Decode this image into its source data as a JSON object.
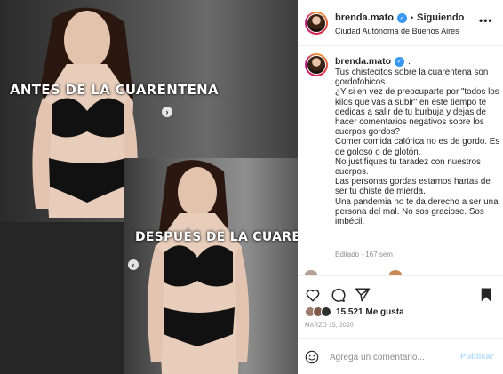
{
  "post": {
    "text_before": "ANTES DE LA CUARENTENA",
    "text_after": "DESPUÉS DE LA CUARENTENA",
    "nav_next_icon": "chevron-right-icon",
    "nav_prev_icon": "chevron-left-icon"
  },
  "header": {
    "username": "brenda.mato",
    "separator": "•",
    "follow_label": "Siguiendo",
    "location": "Ciudad Autónoma de Buenos Aires",
    "more_label": "•••"
  },
  "caption": {
    "username": "brenda.mato",
    "trailing": ".",
    "lines": [
      "Tus chistecitos sobre la cuarentena son gordofobicos.",
      "¿Y si en vez de preocuparte por \"todos los kilos que vas a subir\" en este tiempo te dedicas a salir de tu burbuja y dejas de hacer comentarios negativos sobre los cuerpos gordos?",
      "Comer comida calórica no es de gordo. Es de goloso o de glotón.",
      "No justifiques tu taradez con nuestros cuerpos.",
      "Las personas gordas estamos hartas de ser tu chiste de mierda.",
      "Una pandemia no te da derecho a ser una persona del mal. No sos graciose. Sos imbécil."
    ],
    "edited": "Editado · 167 sem"
  },
  "actions": {
    "like_icon": "heart-icon",
    "comment_icon": "comment-icon",
    "share_icon": "paper-plane-icon",
    "save_icon": "bookmark-icon"
  },
  "likes": {
    "count_label": "15.521 Me gusta"
  },
  "date": "MARZO 15, 2020",
  "comment_box": {
    "placeholder": "Agrega un comentario...",
    "publish_label": "Publicar"
  },
  "colors": {
    "verified": "#3897f0",
    "publish_disabled": "#b3dbff",
    "secondary_text": "#8e8e8e"
  }
}
